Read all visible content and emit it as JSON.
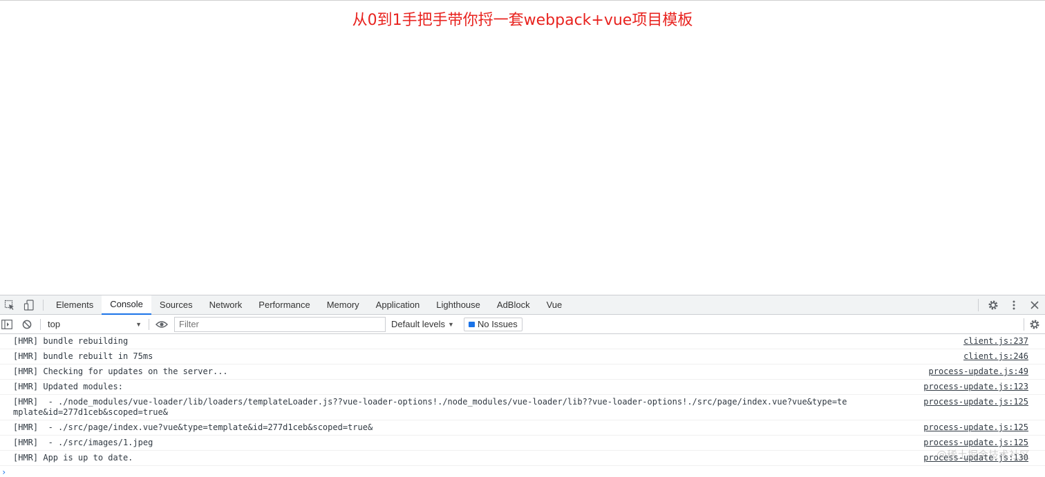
{
  "page": {
    "title": "从0到1手把手带你捋一套webpack+vue项目模板"
  },
  "devtools": {
    "tabs": [
      "Elements",
      "Console",
      "Sources",
      "Network",
      "Performance",
      "Memory",
      "Application",
      "Lighthouse",
      "AdBlock",
      "Vue"
    ],
    "active_tab": "Console",
    "toolbar": {
      "context": "top",
      "filter_placeholder": "Filter",
      "levels": "Default levels",
      "issues": "No Issues"
    },
    "messages": [
      {
        "text": "[HMR] bundle rebuilding",
        "source": "client.js:237"
      },
      {
        "text": "[HMR] bundle rebuilt in 75ms",
        "source": "client.js:246"
      },
      {
        "text": "[HMR] Checking for updates on the server...",
        "source": "process-update.js:49"
      },
      {
        "text": "[HMR] Updated modules:",
        "source": "process-update.js:123"
      },
      {
        "text": "[HMR]  - ./node_modules/vue-loader/lib/loaders/templateLoader.js??vue-loader-options!./node_modules/vue-loader/lib??vue-loader-options!./src/page/index.vue?vue&type=template&id=277d1ceb&scoped=true&",
        "source": "process-update.js:125"
      },
      {
        "text": "[HMR]  - ./src/page/index.vue?vue&type=template&id=277d1ceb&scoped=true&",
        "source": "process-update.js:125"
      },
      {
        "text": "[HMR]  - ./src/images/1.jpeg",
        "source": "process-update.js:125"
      },
      {
        "text": "[HMR] App is up to date.",
        "source": "process-update.js:130"
      }
    ],
    "prompt": "›",
    "watermark": "@稀土掘金技术社区"
  },
  "colors": {
    "title": "#e8231f",
    "accent": "#1a73e8"
  }
}
